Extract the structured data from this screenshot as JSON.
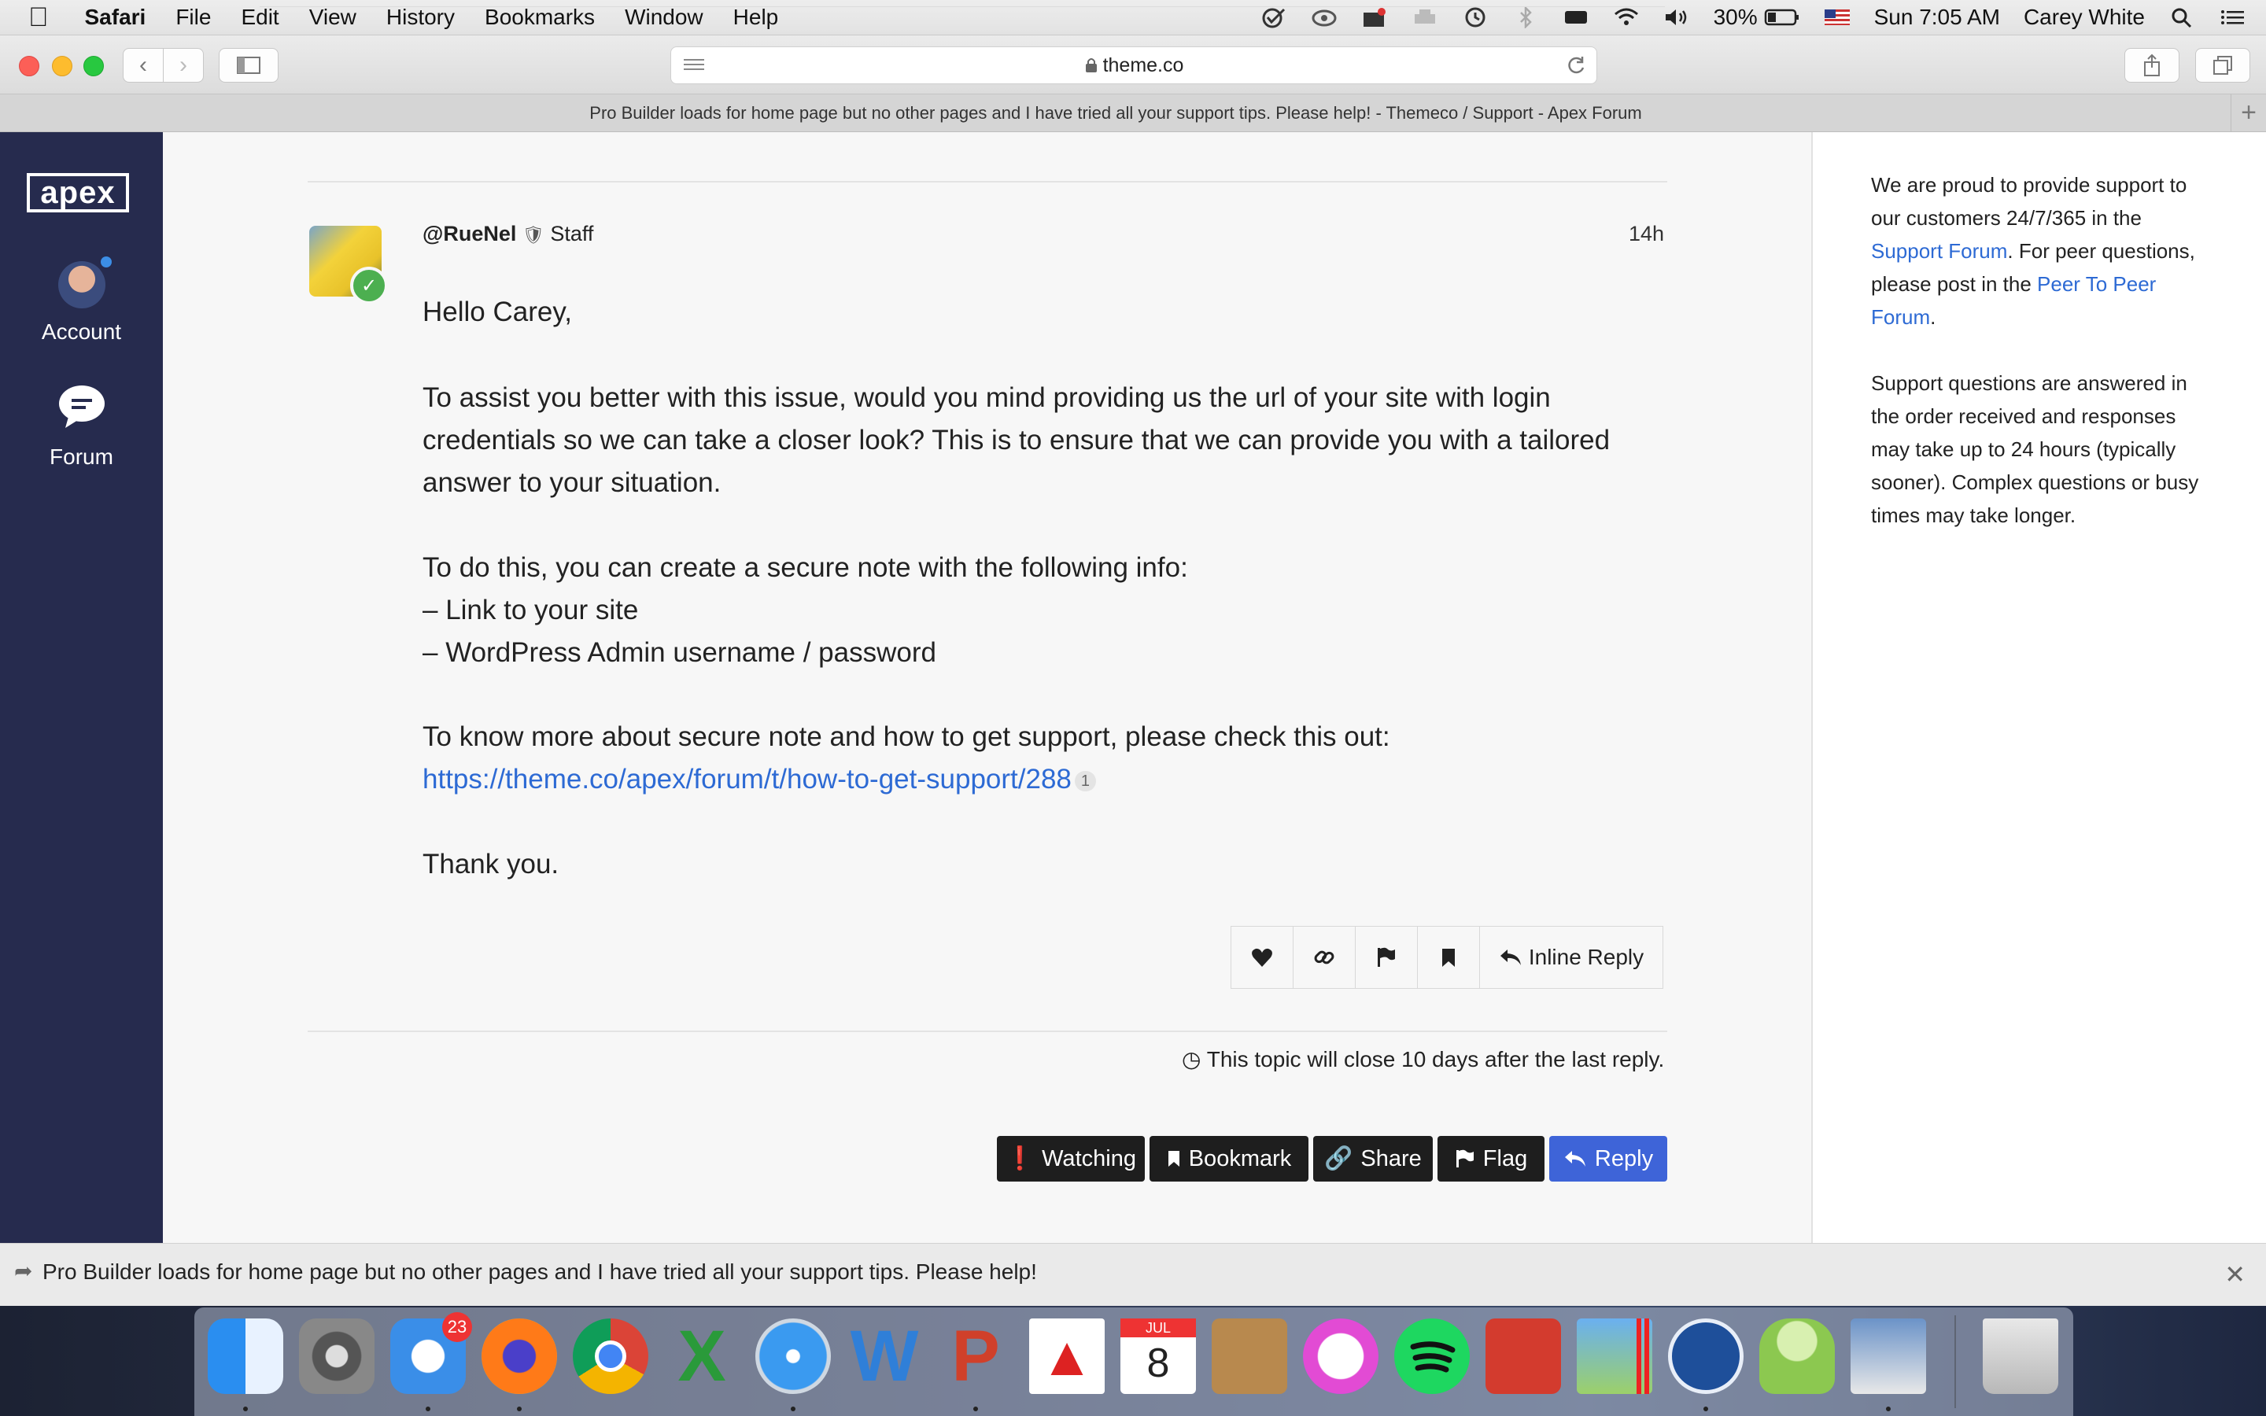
{
  "menubar": {
    "app": "Safari",
    "items": [
      "File",
      "Edit",
      "View",
      "History",
      "Bookmarks",
      "Window",
      "Help"
    ],
    "battery": "30%",
    "clock": "Sun 7:05 AM",
    "user": "Carey White"
  },
  "toolbar": {
    "url": "theme.co"
  },
  "tab": {
    "title": "Pro Builder loads for home page but no other pages and I have tried all your support tips. Please help! - Themeco / Support - Apex Forum"
  },
  "sidenav": {
    "logo": "apex",
    "account_label": "Account",
    "forum_label": "Forum"
  },
  "post": {
    "username": "@RueNel",
    "role": "Staff",
    "time": "14h",
    "greeting": "Hello Carey,",
    "p1_l1": "To assist you better with this issue, would you mind providing us the url of your site with login",
    "p1_l2": "credentials so we can take a closer look? This is to ensure that we can provide you with a tailored",
    "p1_l3": "answer to your situation.",
    "p2_l1": "To do this, you can create a secure note with the following info:",
    "p2_l2": "– Link to your site",
    "p2_l3": "– WordPress Admin username / password",
    "p3_l1": "To know more about secure note and how to get support, please check this out:",
    "link": "https://theme.co/apex/forum/t/how-to-get-support/288",
    "link_count": "1",
    "thanks": "Thank you.",
    "inline_reply_label": "Inline Reply"
  },
  "topic": {
    "close_note": "This topic will close 10 days after the last reply.",
    "buttons": {
      "watching": "Watching",
      "bookmark": "Bookmark",
      "share": "Share",
      "flag": "Flag",
      "reply": "Reply"
    }
  },
  "aside": {
    "p1_a": "We are proud to provide support to our customers 24/7/365 in the ",
    "p1_link1": "Support Forum",
    "p1_b": ". For peer questions, please post in the ",
    "p1_link2": "Peer To Peer Forum",
    "p1_c": ".",
    "p2": "Support questions are answered in the order received and responses may take up to 24 hours (typically sooner). Complex questions or busy times may take longer."
  },
  "bottombar": {
    "title": "Pro Builder loads for home page but no other pages and I have tried all your support tips. Please help!"
  },
  "dock": {
    "mail_badge": "23",
    "calendar_month": "JUL",
    "calendar_day": "8"
  }
}
